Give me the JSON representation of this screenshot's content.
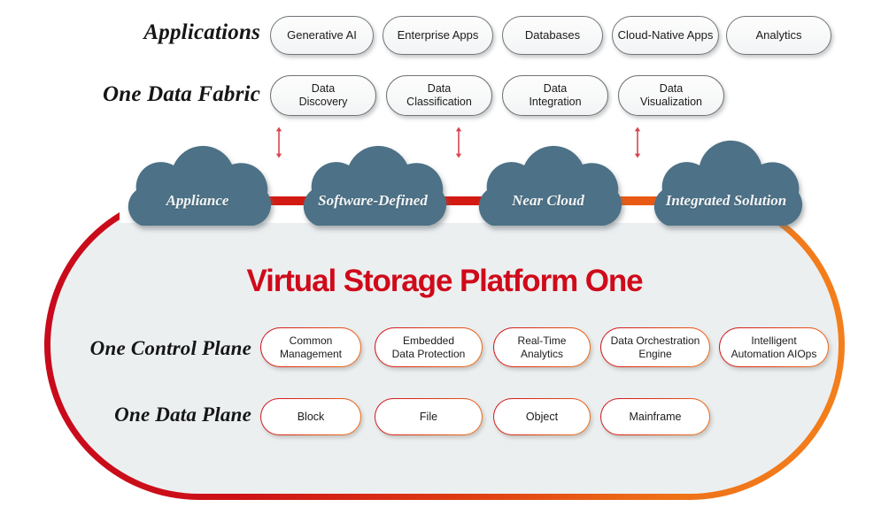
{
  "diagram": {
    "title": "Virtual Storage Platform One",
    "title_color": "#cf0a1a",
    "container_border_start_color": "#c80a1c",
    "container_border_end_color": "#f4801c",
    "container_fill_color": "#eceff0",
    "cloud_fill_color": "#4d7186",
    "connector_colors": [
      "#d31a12",
      "#d31a12",
      "#e85a14"
    ],
    "arrow_color": "#d64550"
  },
  "rows": {
    "applications": {
      "label": "Applications",
      "items": [
        {
          "lines": [
            "Generative AI"
          ]
        },
        {
          "lines": [
            "Enterprise Apps"
          ]
        },
        {
          "lines": [
            "Databases"
          ]
        },
        {
          "lines": [
            "Cloud-Native Apps"
          ]
        },
        {
          "lines": [
            "Analytics"
          ]
        }
      ]
    },
    "data_fabric": {
      "label": "One Data Fabric",
      "items": [
        {
          "lines": [
            "Data",
            "Discovery"
          ]
        },
        {
          "lines": [
            "Data",
            "Classification"
          ]
        },
        {
          "lines": [
            "Data",
            "Integration"
          ]
        },
        {
          "lines": [
            "Data",
            "Visualization"
          ]
        }
      ]
    },
    "clouds": {
      "items": [
        {
          "label": "Appliance"
        },
        {
          "label": "Software-Defined"
        },
        {
          "label": "Near Cloud"
        },
        {
          "label": "Integrated Solution"
        }
      ]
    },
    "control_plane": {
      "label": "One Control Plane",
      "items": [
        {
          "lines": [
            "Common",
            "Management"
          ]
        },
        {
          "lines": [
            "Embedded",
            "Data Protection"
          ]
        },
        {
          "lines": [
            "Real-Time",
            "Analytics"
          ]
        },
        {
          "lines": [
            "Data Orchestration",
            "Engine"
          ]
        },
        {
          "lines": [
            "Intelligent",
            "Automation AIOps"
          ]
        }
      ]
    },
    "data_plane": {
      "label": "One Data Plane",
      "items": [
        {
          "lines": [
            "Block"
          ]
        },
        {
          "lines": [
            "File"
          ]
        },
        {
          "lines": [
            "Object"
          ]
        },
        {
          "lines": [
            "Mainframe"
          ]
        }
      ]
    }
  }
}
